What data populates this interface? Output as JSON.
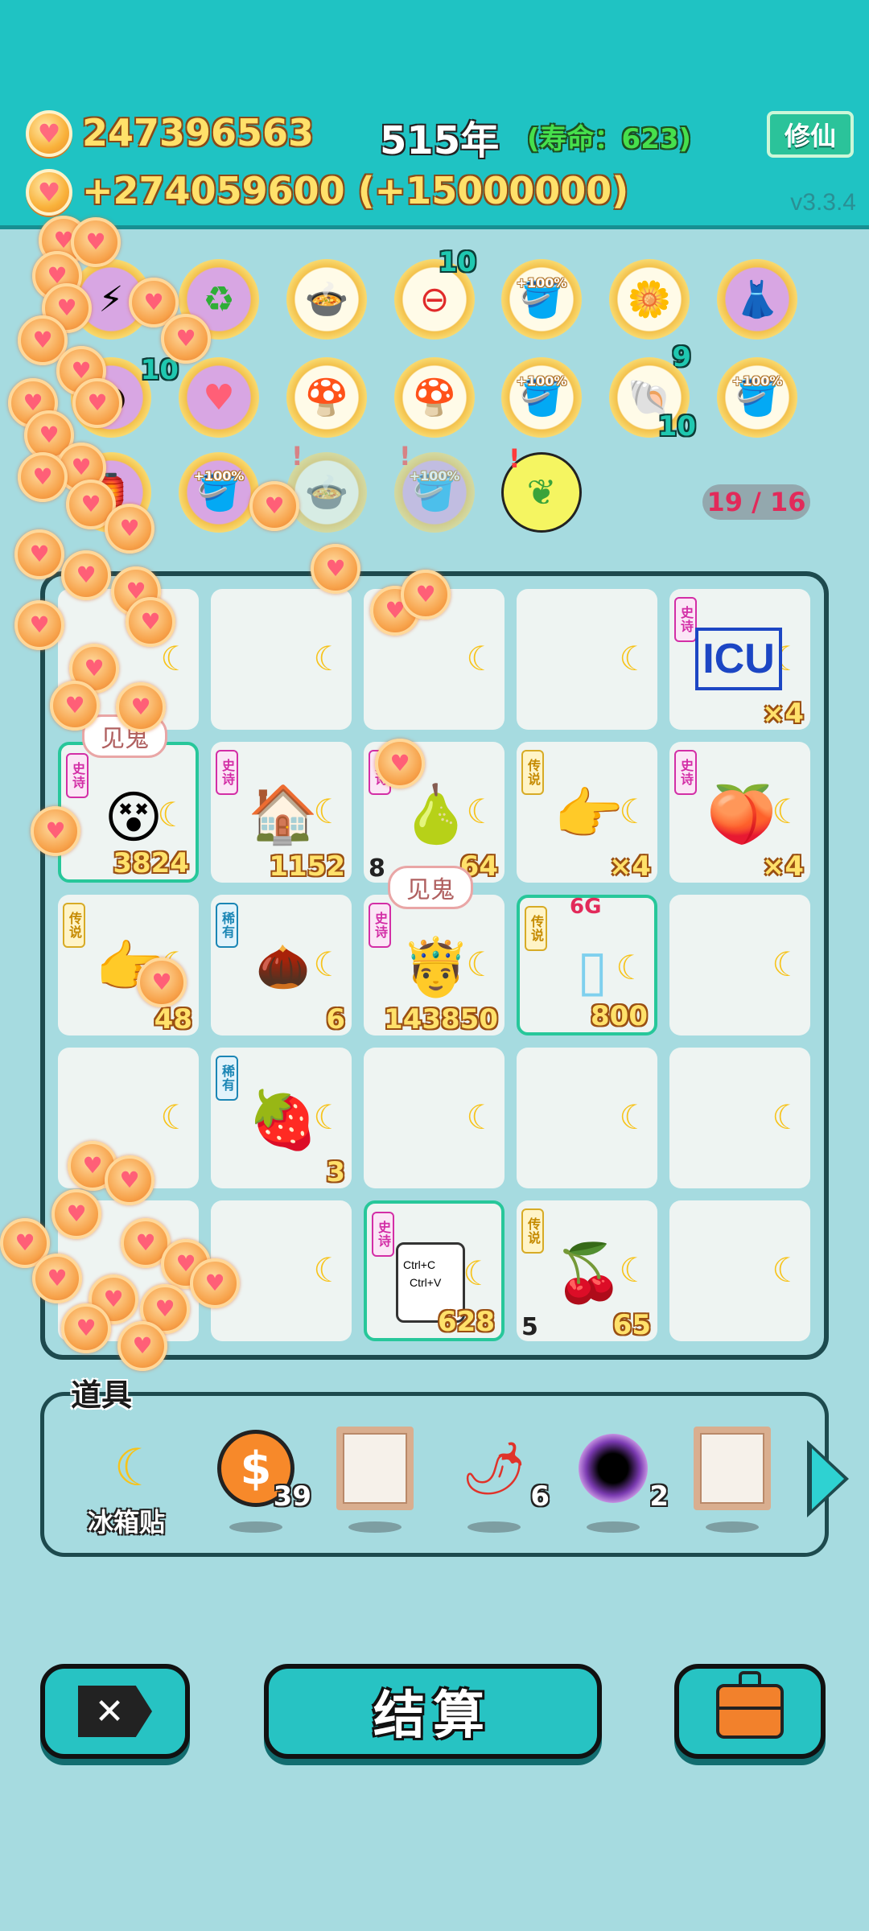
{
  "header": {
    "coins": "247396563",
    "income": "+274059600 (+15000000)",
    "year": "515年",
    "lifespan": "(寿命：623)",
    "cultivate_button": "修仙",
    "version": "v3.3.4"
  },
  "buffs": {
    "row1": [
      {
        "icon": "lightning-icon"
      },
      {
        "icon": "recycle-icon"
      },
      {
        "icon": "pot-duck-icon"
      },
      {
        "icon": "minus-clock-icon",
        "count": "10"
      },
      {
        "icon": "bucket-icon",
        "label": "+100%"
      },
      {
        "icon": "flower-pot-icon",
        "count": "9"
      },
      {
        "icon": "skirt-icon"
      }
    ],
    "row2": [
      {
        "icon": "dark-orb-icon",
        "count": "10"
      },
      {
        "icon": "heart-coin-icon"
      },
      {
        "icon": "mushroom-cloud-icon"
      },
      {
        "icon": "mushroom-cloud-icon"
      },
      {
        "icon": "bucket-icon",
        "label": "+100%"
      },
      {
        "icon": "shell-icon",
        "count": "10"
      },
      {
        "icon": "bucket-icon",
        "label": "+100%"
      }
    ],
    "row3": [
      {
        "icon": "lamp-icon"
      },
      {
        "icon": "bucket-icon",
        "label": "+100%"
      },
      {
        "icon": "pot-duck-icon",
        "alert": "!"
      },
      {
        "icon": "bucket-icon",
        "label": "+100%",
        "alert": "!"
      },
      {
        "icon": "leaf-icon",
        "alert": "!"
      }
    ],
    "counter": "19 / 16"
  },
  "board": {
    "bubble_text": "见鬼",
    "cells": {
      "r1c5": {
        "tag": "史诗",
        "mult": "×4"
      },
      "r2c1": {
        "tag": "史诗",
        "value": "3824"
      },
      "r2c2": {
        "tag": "史诗",
        "value": "1152"
      },
      "r2c3": {
        "tag": "史诗",
        "left": "8",
        "value": "64"
      },
      "r2c4": {
        "tag": "传说",
        "mult": "×4"
      },
      "r2c5": {
        "tag": "史诗",
        "mult": "×4"
      },
      "r3c1": {
        "tag": "传说",
        "value": "48"
      },
      "r3c2": {
        "tag": "稀有",
        "value": "6"
      },
      "r3c3": {
        "tag": "史诗",
        "value": "143850"
      },
      "r3c4": {
        "tag": "传说",
        "value": "800",
        "g": "6G"
      },
      "r4c2": {
        "tag": "稀有",
        "value": "3"
      },
      "r5c3": {
        "tag": "史诗",
        "value": "628",
        "paste": [
          "Ctrl+C",
          "Ctrl+V"
        ]
      },
      "r5c4": {
        "tag": "传说",
        "left": "5",
        "value": "65"
      }
    },
    "icu": "ICU"
  },
  "tools": {
    "title": "道具",
    "items": [
      {
        "icon": "moon-sticker-icon",
        "label": "冰箱贴"
      },
      {
        "icon": "dollar-coin-icon",
        "count": "39"
      },
      {
        "icon": "frame-icon"
      },
      {
        "icon": "pepper-icon",
        "count": "6"
      },
      {
        "icon": "black-hole-icon",
        "count": "2"
      },
      {
        "icon": "frame-icon"
      }
    ]
  },
  "actions": {
    "settle": "结算"
  },
  "colors": {
    "header_bg": "#1fc3c3",
    "page_bg": "#a6dbe0",
    "coin_text": "#ffe16a",
    "accent_button": "#27c3c3"
  }
}
